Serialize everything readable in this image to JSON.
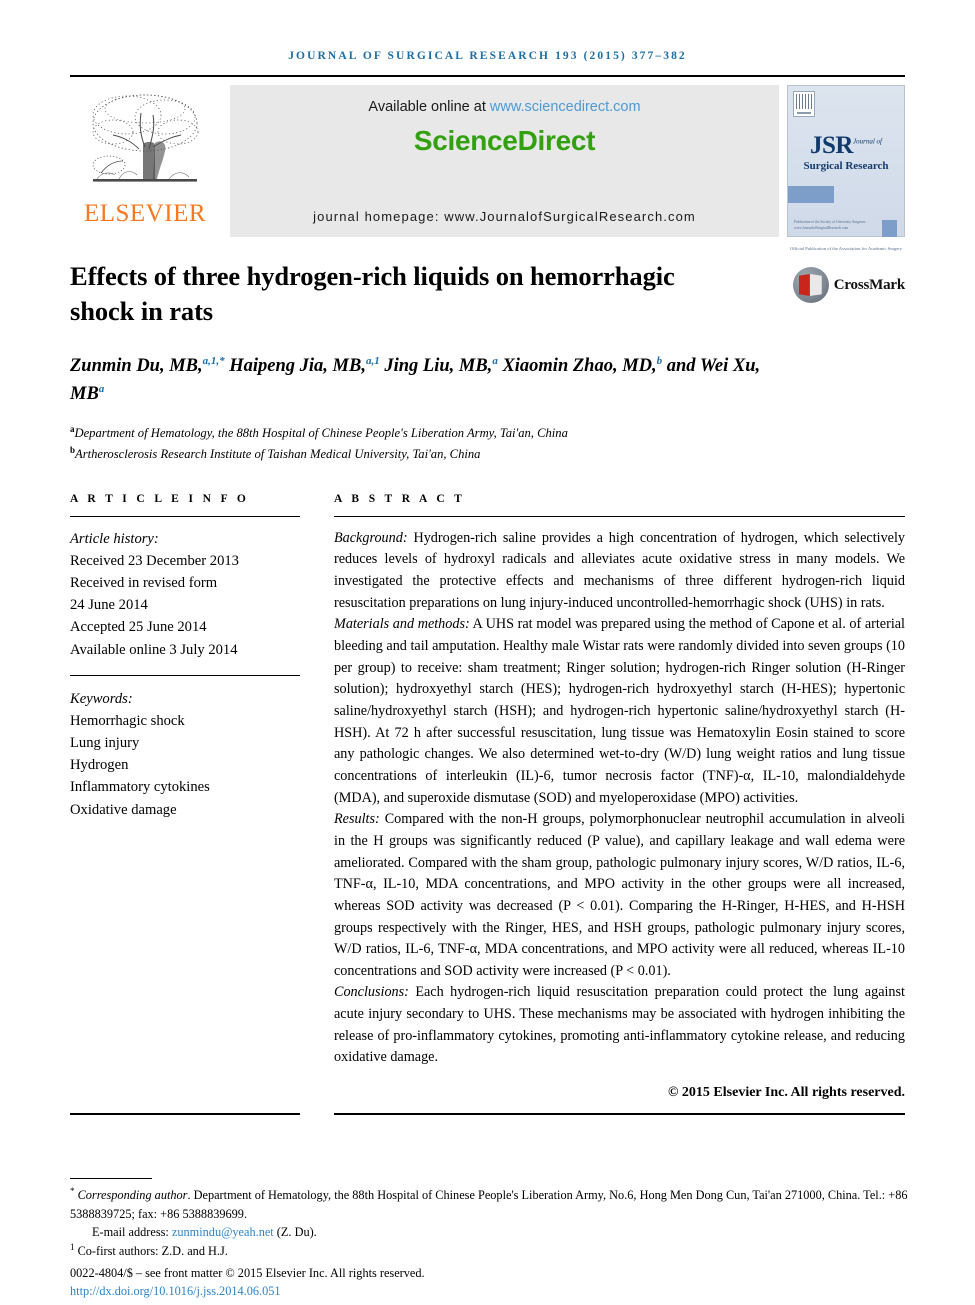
{
  "running_head": "JOURNAL OF SURGICAL RESEARCH 193 (2015) 377–382",
  "masthead": {
    "publisher_name": "ELSEVIER",
    "available_text": "Available online at ",
    "available_link": "www.sciencedirect.com",
    "sciencedirect_logo": "ScienceDirect",
    "journal_homepage": "journal homepage: www.JournalofSurgicalResearch.com",
    "cover": {
      "title": "JSR",
      "title_sup": "Journal of",
      "subtitle": "Surgical Research",
      "middle_text": "Official Publication of the\nAssociation for Academic Surgery",
      "foot_text": "Publication of the Society of University Surgeons\nwww.JournalofSurgicalResearch.com"
    }
  },
  "article": {
    "title": "Effects of three hydrogen-rich liquids on hemorrhagic shock in rats",
    "crossmark_label": "CrossMark",
    "authors_html": "Zunmin Du, MB,<sup>a,1,*</sup> Haipeng Jia, MB,<sup>a,1</sup> Jing Liu, MB,<sup>a</sup> Xiaomin Zhao, MD,<sup>b</sup> and Wei Xu, MB<sup>a</sup>",
    "affiliations": [
      {
        "marker": "a",
        "text": "Department of Hematology, the 88th Hospital of Chinese People's Liberation Army, Tai'an, China"
      },
      {
        "marker": "b",
        "text": "Artherosclerosis Research Institute of Taishan Medical University, Tai'an, China"
      }
    ]
  },
  "article_info": {
    "heading": "A R T I C L E   I N F O",
    "history_label": "Article history:",
    "history": [
      "Received 23 December 2013",
      "Received in revised form",
      "24 June 2014",
      "Accepted 25 June 2014",
      "Available online 3 July 2014"
    ],
    "keywords_label": "Keywords:",
    "keywords": [
      "Hemorrhagic shock",
      "Lung injury",
      "Hydrogen",
      "Inflammatory cytokines",
      "Oxidative damage"
    ]
  },
  "abstract": {
    "heading": "A B S T R A C T",
    "sections": [
      {
        "label": "Background:",
        "text": " Hydrogen-rich saline provides a high concentration of hydrogen, which selectively reduces levels of hydroxyl radicals and alleviates acute oxidative stress in many models. We investigated the protective effects and mechanisms of three different hydrogen-rich liquid resuscitation preparations on lung injury-induced uncontrolled-hemorrhagic shock (UHS) in rats."
      },
      {
        "label": "Materials and methods:",
        "text": " A UHS rat model was prepared using the method of Capone et al. of arterial bleeding and tail amputation. Healthy male Wistar rats were randomly divided into seven groups (10 per group) to receive: sham treatment; Ringer solution; hydrogen-rich Ringer solution (H-Ringer solution); hydroxyethyl starch (HES); hydrogen-rich hydroxyethyl starch (H-HES); hypertonic saline/hydroxyethyl starch (HSH); and hydrogen-rich hypertonic saline/hydroxyethyl starch (H-HSH). At 72 h after successful resuscitation, lung tissue was Hematoxylin Eosin stained to score any pathologic changes. We also determined wet-to-dry (W/D) lung weight ratios and lung tissue concentrations of interleukin (IL)-6, tumor necrosis factor (TNF)-α, IL-10, malondialdehyde (MDA), and superoxide dismutase (SOD) and myeloperoxidase (MPO) activities."
      },
      {
        "label": "Results:",
        "text": " Compared with the non-H groups, polymorphonuclear neutrophil accumulation in alveoli in the H groups was significantly reduced (P value), and capillary leakage and wall edema were ameliorated. Compared with the sham group, pathologic pulmonary injury scores, W/D ratios, IL-6, TNF-α, IL-10, MDA concentrations, and MPO activity in the other groups were all increased, whereas SOD activity was decreased (P < 0.01). Comparing the H-Ringer, H-HES, and H-HSH groups respectively with the Ringer, HES, and HSH groups, pathologic pulmonary injury scores, W/D ratios, IL-6, TNF-α, MDA concentrations, and MPO activity were all reduced, whereas IL-10 concentrations and SOD activity were increased (P < 0.01)."
      },
      {
        "label": "Conclusions:",
        "text": " Each hydrogen-rich liquid resuscitation preparation could protect the lung against acute injury secondary to UHS. These mechanisms may be associated with hydrogen inhibiting the release of pro-inflammatory cytokines, promoting anti-inflammatory cytokine release, and reducing oxidative damage."
      }
    ],
    "copyright": "© 2015 Elsevier Inc. All rights reserved."
  },
  "footnotes": {
    "corresponding_label": "Corresponding author",
    "corresponding_text": ". Department of Hematology, the 88th Hospital of Chinese People's Liberation Army, No.6, Hong Men Dong Cun, Tai'an 271000, China. Tel.: +86 5388839725; fax: +86 5388839699.",
    "email_label": "E-mail address: ",
    "email": "zunmindu@yeah.net",
    "email_suffix": " (Z. Du).",
    "cofirst": "Co-first authors: Z.D. and H.J.",
    "issn_line": "0022-4804/$ – see front matter © 2015 Elsevier Inc. All rights reserved.",
    "doi": "http://dx.doi.org/10.1016/j.jss.2014.06.051"
  },
  "colors": {
    "journal_blue": "#1c6ea4",
    "link_blue": "#4a9bd4",
    "sciencedirect_green": "#33a00f",
    "elsevier_orange": "#F47920",
    "cover_blue": "#dce4ee",
    "crossmark_red": "#c8261d"
  }
}
